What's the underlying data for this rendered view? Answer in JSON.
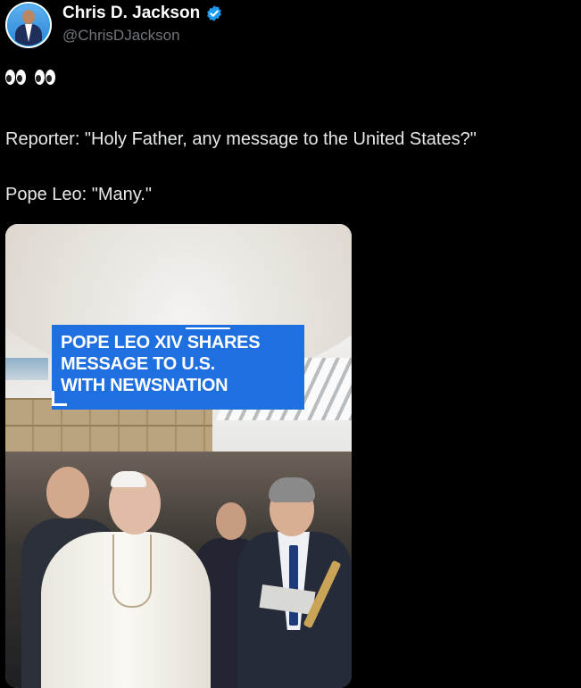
{
  "author": {
    "name": "Chris D. Jackson",
    "handle": "@ChrisDJackson",
    "verified": true,
    "avatar_icon": "avatar-photo"
  },
  "post": {
    "emoji": "eyes-emoji eyes-emoji",
    "line1": "Reporter: \"Holy Father, any message to the United States?\"",
    "line2": "Pope Leo: \"Many.\""
  },
  "media": {
    "chyron": "POPE LEO XIV SHARES\nMESSAGE TO U.S.\nWITH NEWSNATION",
    "chyron_color": "#1e6fe0"
  },
  "colors": {
    "background": "#000000",
    "text": "#e7e9ea",
    "handle": "#71767b",
    "verified": "#1d9bf0"
  }
}
